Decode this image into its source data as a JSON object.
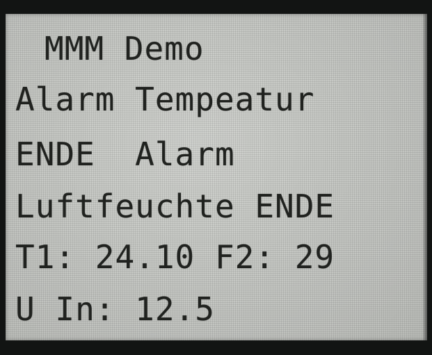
{
  "display": {
    "lines": [
      "MMM Demo",
      "Alarm Tempeatur",
      "ENDE  Alarm",
      "Luftfeuchte ENDE",
      "T1: 24.10 F2: 29",
      "U In: 12.5"
    ]
  }
}
